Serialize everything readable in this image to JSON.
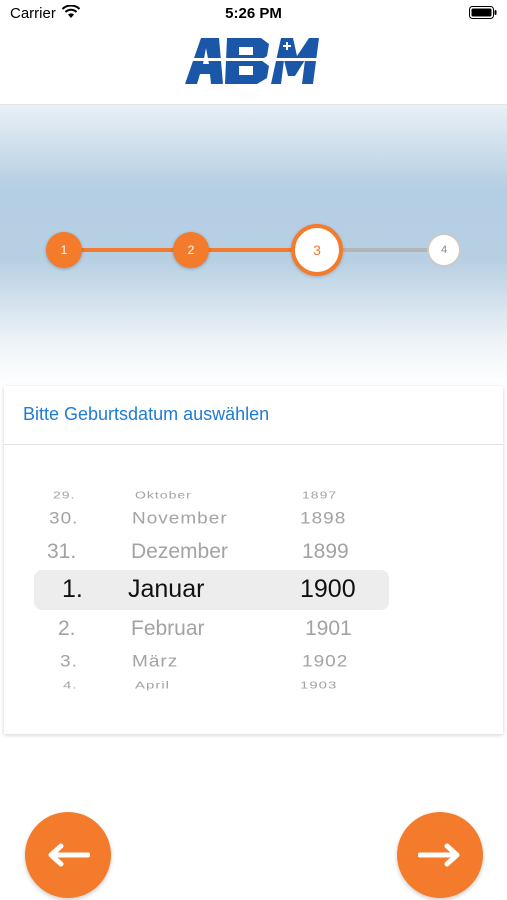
{
  "status_bar": {
    "carrier": "Carrier",
    "time": "5:26 PM"
  },
  "brand": {
    "logo_text": "ABM"
  },
  "progress": {
    "steps": [
      "1",
      "2",
      "3",
      "4"
    ],
    "current_step": 3,
    "accent_color": "#f47a2c"
  },
  "card": {
    "title": "Bitte Geburtsdatum auswählen"
  },
  "picker": {
    "days": [
      "29.",
      "30.",
      "31.",
      "1.",
      "2.",
      "3.",
      "4."
    ],
    "months": [
      "Oktober",
      "November",
      "Dezember",
      "Januar",
      "Februar",
      "März",
      "April"
    ],
    "years": [
      "1897",
      "1898",
      "1899",
      "1900",
      "1901",
      "1902",
      "1903"
    ],
    "selected": {
      "day": "1.",
      "month": "Januar",
      "year": "1900"
    }
  },
  "nav": {
    "back_icon": "arrow-left-icon",
    "next_icon": "arrow-right-icon"
  }
}
